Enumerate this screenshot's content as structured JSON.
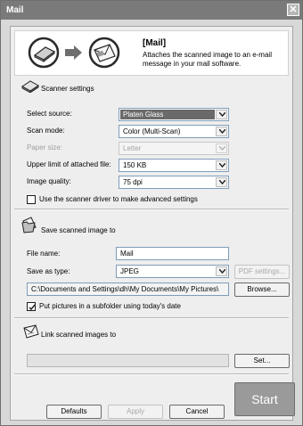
{
  "window": {
    "title": "Mail"
  },
  "banner": {
    "title": "[Mail]",
    "description": "Attaches the scanned image to an e-mail message in your mail software."
  },
  "scanner_settings": {
    "heading": "Scanner settings",
    "select_source": {
      "label": "Select source:",
      "value": "Platen Glass"
    },
    "scan_mode": {
      "label": "Scan mode:",
      "value": "Color (Multi-Scan)"
    },
    "paper_size": {
      "label": "Paper size:",
      "value": "Letter"
    },
    "upper_limit": {
      "label": "Upper limit of attached file:",
      "value": "150 KB"
    },
    "image_quality": {
      "label": "Image quality:",
      "value": "75 dpi"
    },
    "advanced": {
      "label": "Use the scanner driver to make advanced settings",
      "checked": false
    }
  },
  "save_settings": {
    "heading": "Save scanned image to",
    "file_name": {
      "label": "File name:",
      "value": "Mail"
    },
    "save_as_type": {
      "label": "Save as type:",
      "value": "JPEG"
    },
    "pdf_settings_label": "PDF settings...",
    "path": "C:\\Documents and Settings\\dh\\My Documents\\My Pictures\\",
    "browse_label": "Browse...",
    "subfolder": {
      "label": "Put pictures in a subfolder using today's date",
      "checked": true
    }
  },
  "link_settings": {
    "heading": "Link scanned images to",
    "value": "",
    "set_label": "Set..."
  },
  "footer": {
    "defaults_label": "Defaults",
    "apply_label": "Apply",
    "cancel_label": "Cancel",
    "start_label": "Start"
  }
}
